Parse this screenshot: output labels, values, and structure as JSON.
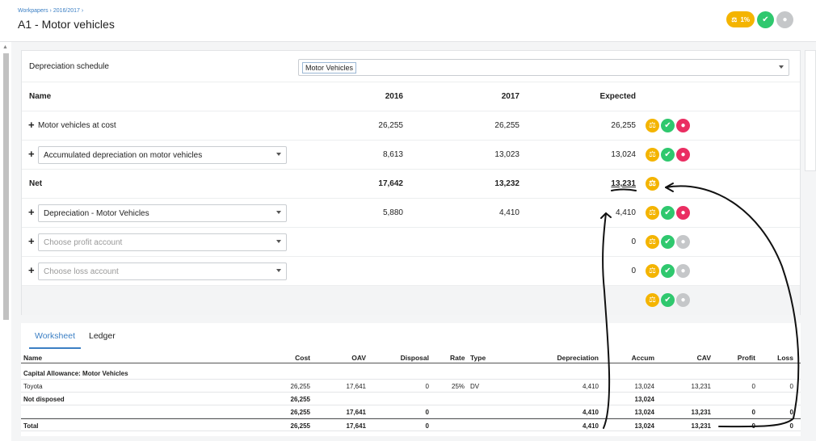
{
  "header": {
    "breadcrumb": "Workpapers › 2016/2017 ›",
    "title": "A1 - Motor vehicles",
    "progress_label": "1%"
  },
  "schedule": {
    "label": "Depreciation schedule",
    "selected": "Motor Vehicles"
  },
  "table": {
    "columns": {
      "name": "Name",
      "y2016": "2016",
      "y2017": "2017",
      "expected": "Expected"
    },
    "rows": [
      {
        "name": "Motor vehicles at cost",
        "v2016": "26,255",
        "v2017": "26,255",
        "expected": "26,255"
      },
      {
        "name": "Accumulated depreciation on motor vehicles",
        "v2016": "8,613",
        "v2017": "13,023",
        "expected": "13,024"
      },
      {
        "name": "Net",
        "v2016": "17,642",
        "v2017": "13,232",
        "expected": "13,231"
      },
      {
        "name": "Depreciation - Motor Vehicles",
        "v2016": "5,880",
        "v2017": "4,410",
        "expected": "4,410"
      },
      {
        "name": "Choose profit account",
        "expected": "0"
      },
      {
        "name": "Choose loss account",
        "expected": "0"
      }
    ]
  },
  "tabs": {
    "worksheet": "Worksheet",
    "ledger": "Ledger"
  },
  "worksheet": {
    "headers": [
      "Name",
      "Cost",
      "OAV",
      "Disposal",
      "Rate",
      "Type",
      "Depreciation",
      "Accum",
      "CAV",
      "Profit",
      "Loss"
    ],
    "section_title": "Capital Allowance: Motor Vehicles",
    "toyota": {
      "name": "Toyota",
      "cost": "26,255",
      "oav": "17,641",
      "disposal": "0",
      "rate": "25%",
      "type": "DV",
      "depreciation": "4,410",
      "accum": "13,024",
      "cav": "13,231",
      "profit": "0",
      "loss": "0"
    },
    "not_disposed": {
      "name": "Not disposed",
      "cost": "26,255",
      "accum": "13,024"
    },
    "subtotal": {
      "cost": "26,255",
      "oav": "17,641",
      "disposal": "0",
      "depreciation": "4,410",
      "accum": "13,024",
      "cav": "13,231",
      "profit": "0",
      "loss": "0"
    },
    "total": {
      "name": "Total",
      "cost": "26,255",
      "oav": "17,641",
      "disposal": "0",
      "depreciation": "4,410",
      "accum": "13,024",
      "cav": "13,231",
      "profit": "0",
      "loss": "0"
    }
  },
  "colors": {
    "accent": "#3b7fc4",
    "review": "#f4b400",
    "done": "#2fc86e",
    "pending": "#ea2e62",
    "inactive": "#c5c7c9"
  }
}
